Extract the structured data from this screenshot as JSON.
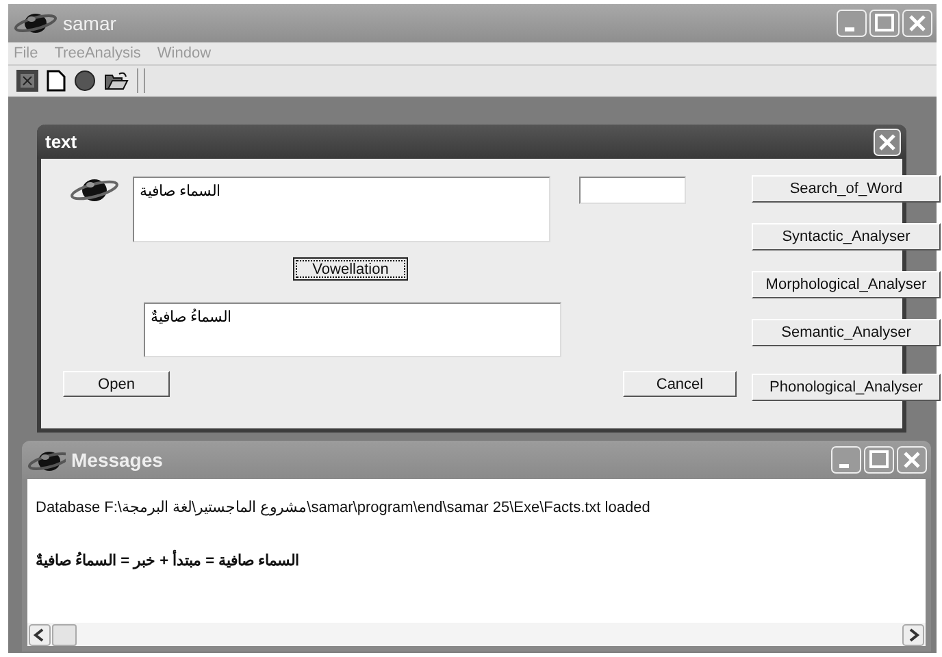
{
  "window": {
    "title": "samar"
  },
  "menu": [
    "File",
    "TreeAnalysis",
    "Window"
  ],
  "dialog": {
    "title": "text",
    "source_text": "السماء صافية",
    "vowellation_button": {
      "label": "Vowellation",
      "focused": true
    },
    "result_text": "السماءُ صافيةٌ",
    "open_button": "Open",
    "cancel_button": "Cancel",
    "analysis_buttons": [
      "Search_of_Word",
      "Syntactic_Analyser",
      "Morphological_Analyser",
      "Semantic_Analyser",
      "Phonological_Analyser"
    ]
  },
  "messages": {
    "title": "Messages",
    "lines": [
      {
        "kind": "log",
        "text": "Database F:\\مشروع الماجستير\\لغة البرمجة\\samar\\program\\end\\samar 25\\Exe\\Facts.txt loaded"
      },
      {
        "kind": "analysis",
        "text": "السماء صافية  =  مبتدأ  +  خبر = السماءُ صافيةٌ"
      }
    ]
  }
}
